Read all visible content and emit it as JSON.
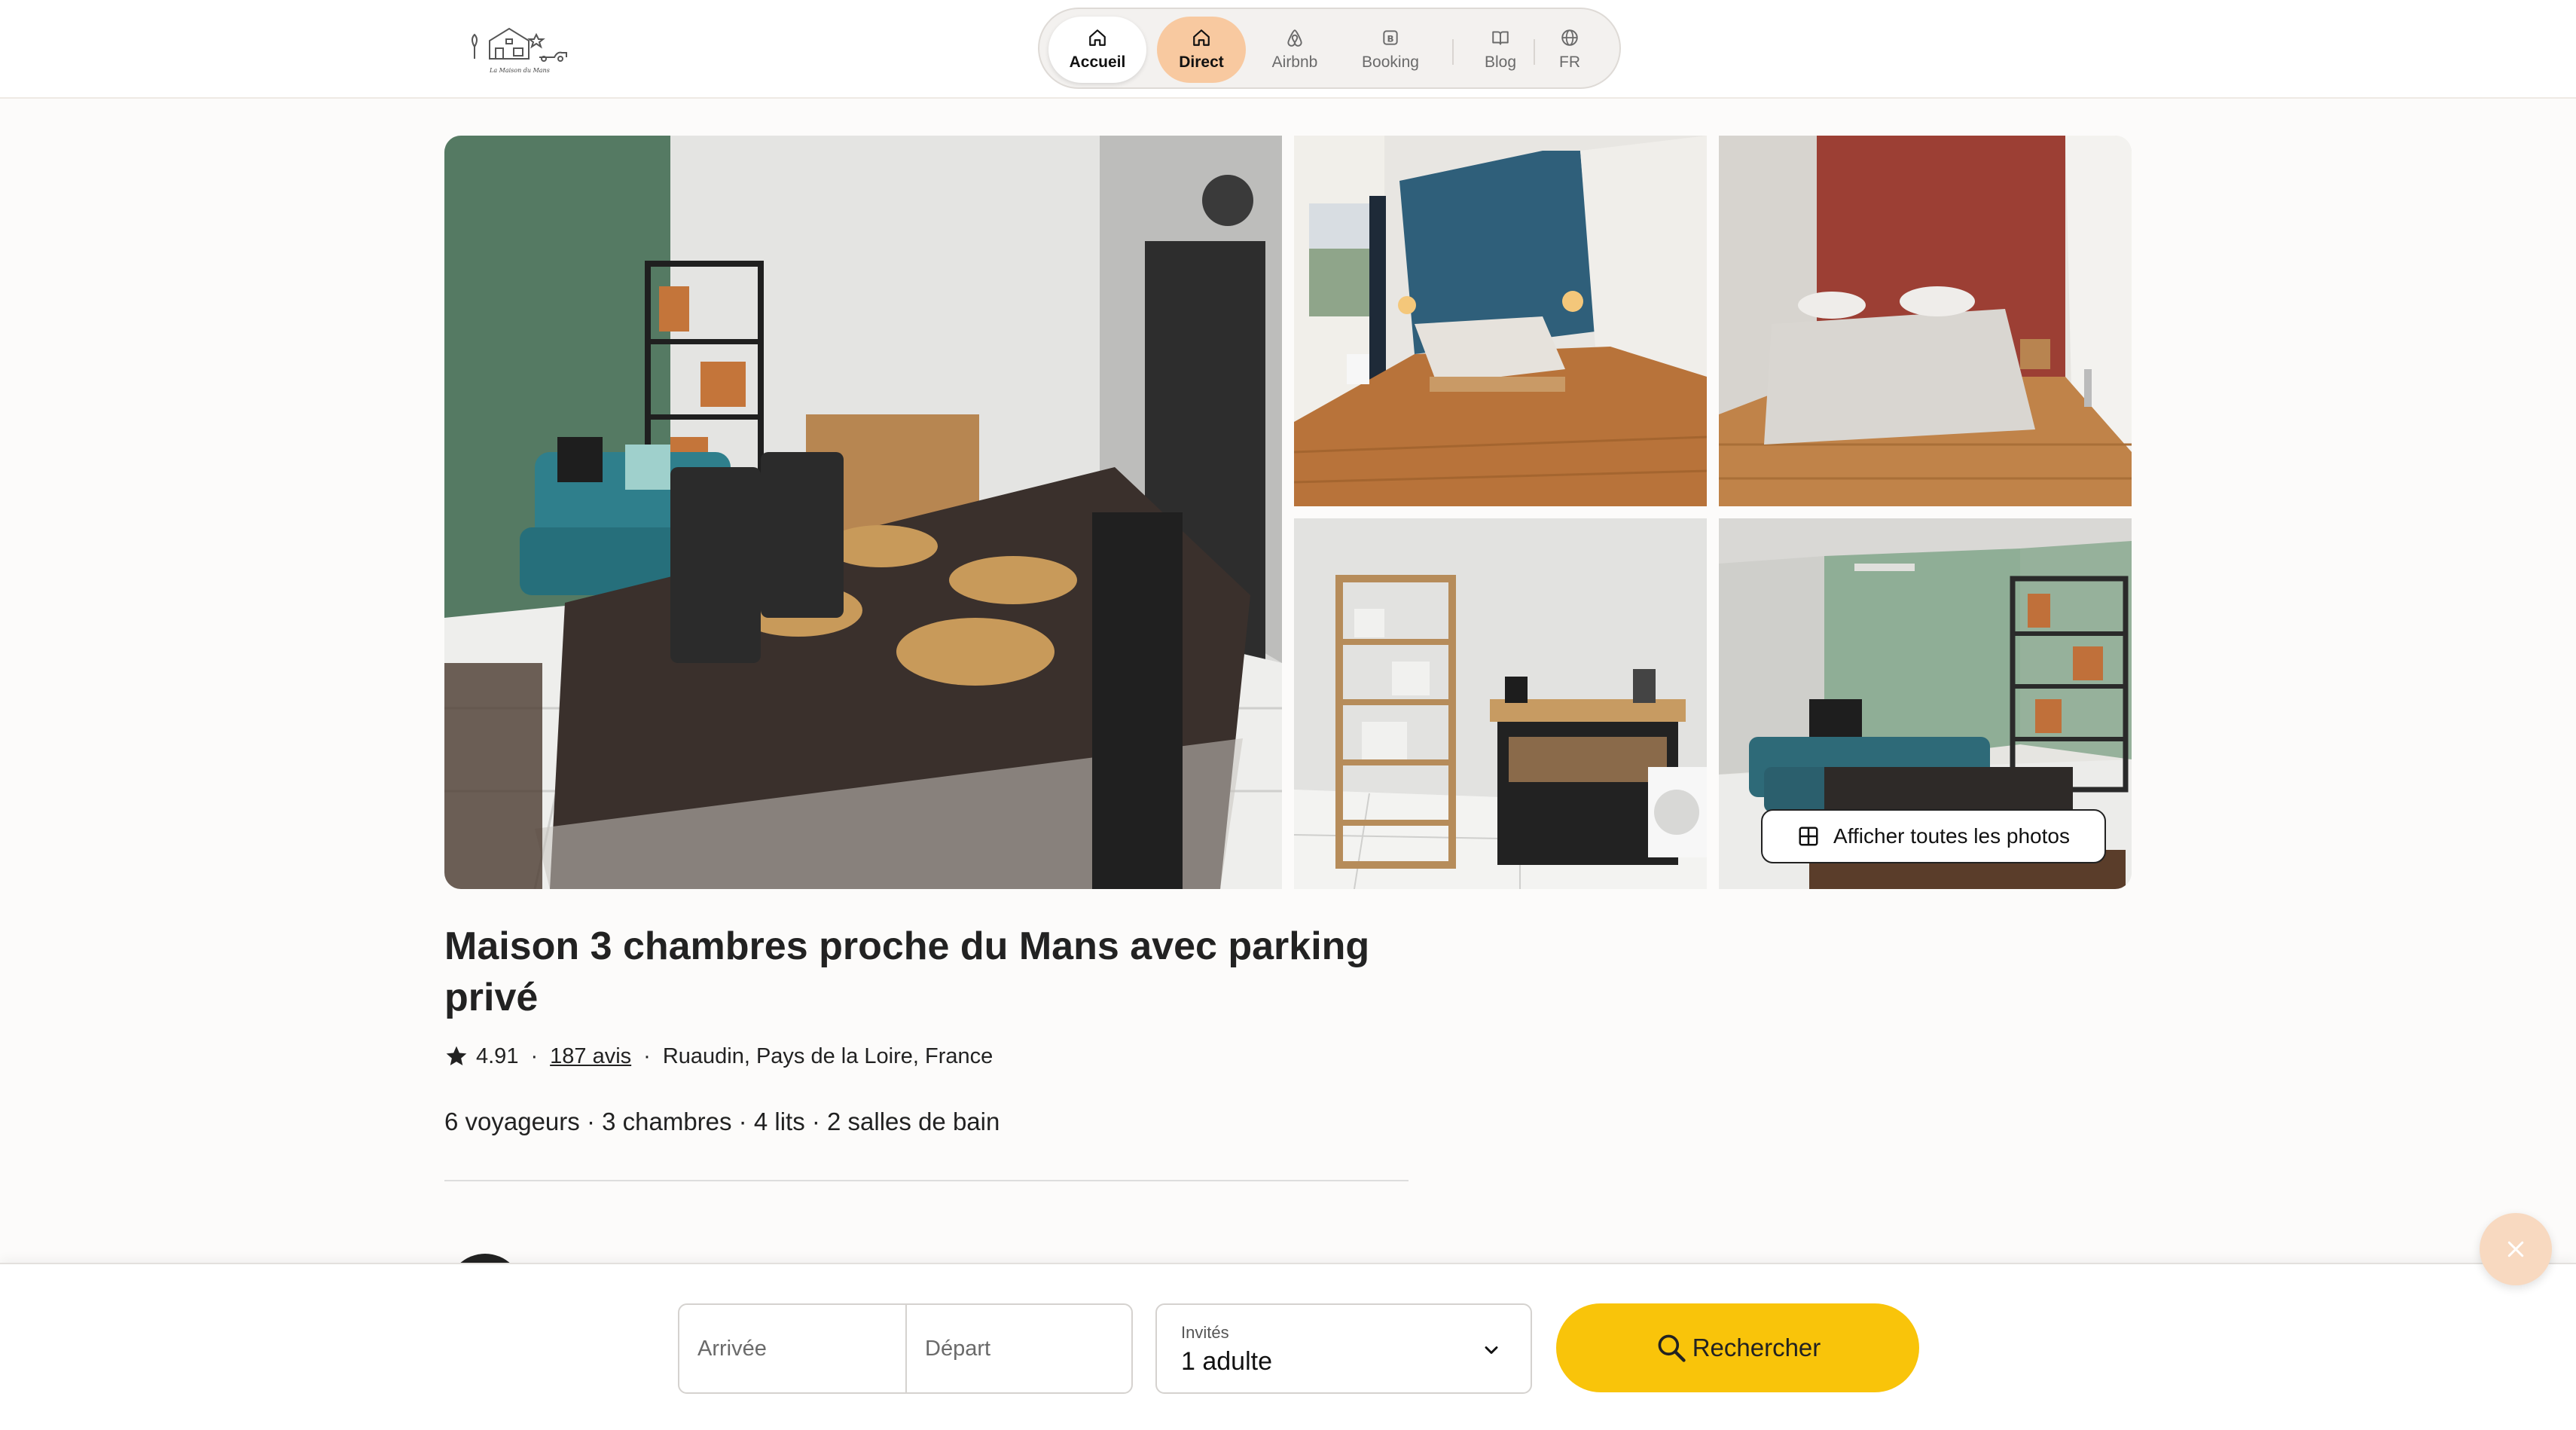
{
  "header": {
    "logo_icon": "house-logo-icon",
    "nav": [
      {
        "label": "Accueil",
        "icon": "home-icon"
      },
      {
        "label": "Direct",
        "icon": "home-icon"
      },
      {
        "label": "Airbnb",
        "icon": "airbnb-icon"
      },
      {
        "label": "Booking",
        "icon": "booking-icon"
      },
      {
        "label": "Blog",
        "icon": "book-icon"
      },
      {
        "label": "FR",
        "icon": "globe-icon"
      }
    ],
    "active_tab": "Direct",
    "accent_color": "#f8c9a0"
  },
  "gallery": {
    "show_all_label": "Afficher toutes les photos"
  },
  "listing": {
    "title": "Maison 3 chambres proche du Mans avec parking privé",
    "rating": "4.91",
    "reviews": "187 avis",
    "location": "Ruaudin, Pays de la Loire, France",
    "capacity": "6 voyageurs · 3 chambres · 4 lits · 2 salles de bain"
  },
  "booking_bar": {
    "arrival_placeholder": "Arrivée",
    "departure_placeholder": "Départ",
    "guests_label": "Invités",
    "guests_value": "1 adulte",
    "search_label": "Rechercher",
    "search_color": "#f9c40a"
  }
}
